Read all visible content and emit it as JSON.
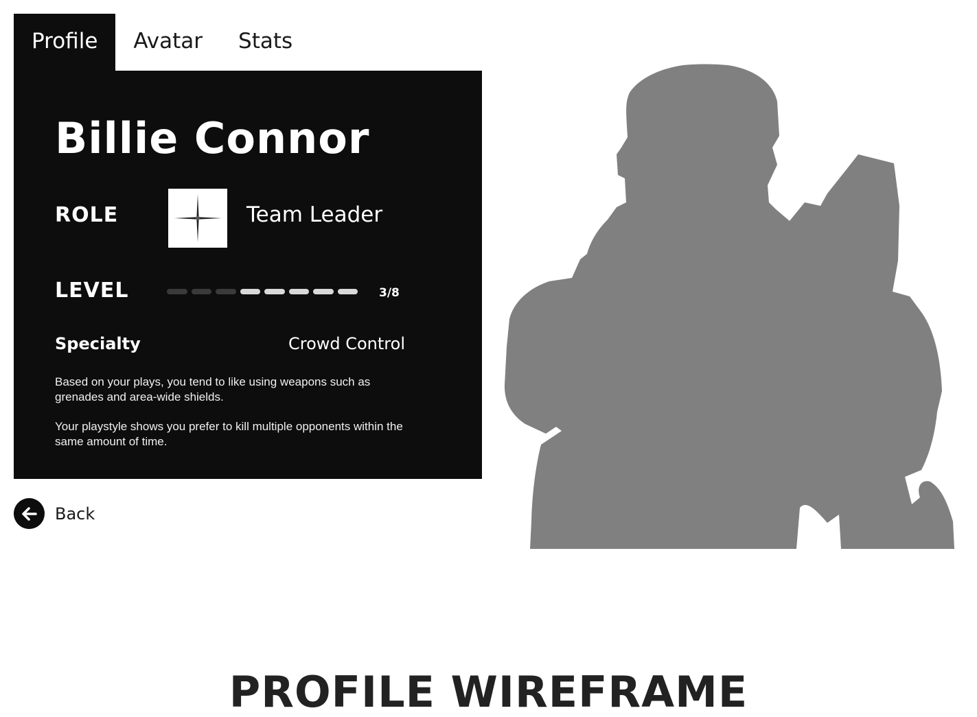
{
  "tabs": [
    {
      "label": "Profile",
      "active": true
    },
    {
      "label": "Avatar",
      "active": false
    },
    {
      "label": "Stats",
      "active": false
    }
  ],
  "profile": {
    "name": "Billie Connor",
    "role_label": "ROLE",
    "role_icon": "sparkle-icon",
    "role_value": "Team Leader",
    "level_label": "LEVEL",
    "level_current": 3,
    "level_max": 8,
    "level_text": "3/8",
    "specialty_label": "Specialty",
    "specialty_value": "Crowd Control",
    "description": [
      "Based on your plays, you tend to like using weapons such as grenades and area-wide shields.",
      "Your playstyle shows you prefer to kill multiple opponents within the same amount of time."
    ]
  },
  "back": {
    "label": "Back",
    "icon": "arrow-left-icon"
  },
  "avatar": {
    "icon": "character-silhouette",
    "color": "#808080"
  },
  "footer": {
    "title": "PROFILE WIREFRAME"
  },
  "colors": {
    "panel": "#0d0d0d",
    "level_active": "#d9d9d9",
    "level_inactive": "#3a3a3a"
  }
}
